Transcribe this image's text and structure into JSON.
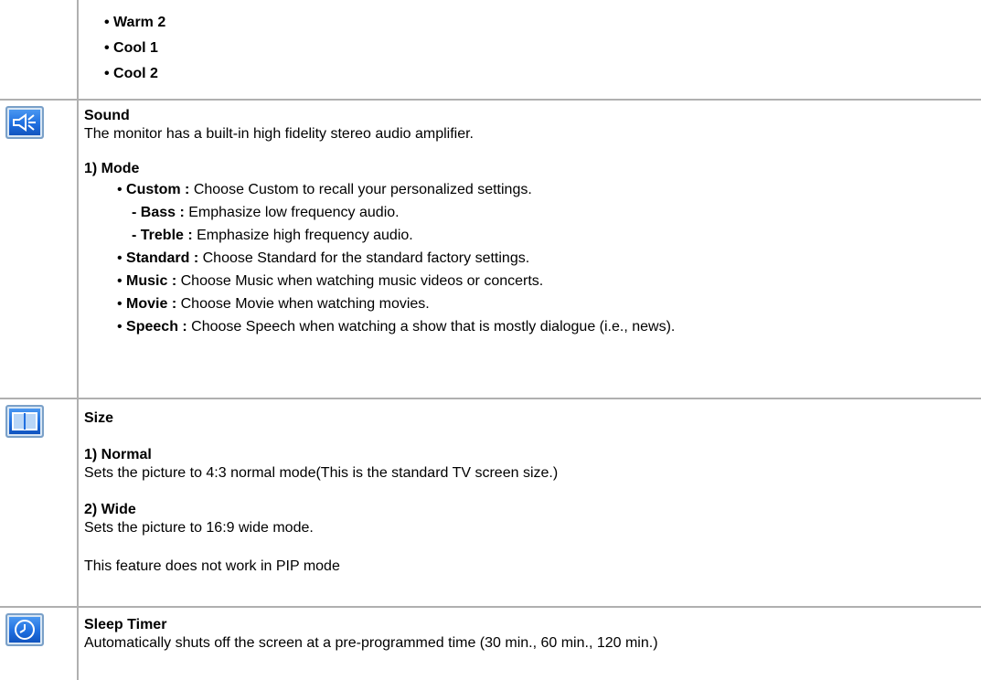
{
  "top": {
    "items": [
      "Warm 2",
      "Cool 1",
      "Cool 2"
    ]
  },
  "sound": {
    "icon": "speaker-icon",
    "title": "Sound",
    "description": "The monitor has a built-in high fidelity stereo audio amplifier.",
    "mode_heading": "1) Mode",
    "custom": {
      "label": "Custom :",
      "text": " Choose Custom to recall your personalized settings."
    },
    "bass": {
      "label": "- Bass :",
      "text": " Emphasize low frequency audio."
    },
    "treble": {
      "label": "- Treble :",
      "text": " Emphasize high frequency audio."
    },
    "standard": {
      "label": "Standard :",
      "text": " Choose Standard for the standard factory settings."
    },
    "music": {
      "label": "Music :",
      "text": " Choose Music when watching music videos or concerts."
    },
    "movie": {
      "label": "Movie :",
      "text": " Choose Movie when watching movies."
    },
    "speech": {
      "label": "Speech :",
      "text": " Choose Speech when watching a show that is mostly dialogue (i.e., news)."
    }
  },
  "size": {
    "icon": "screen-size-icon",
    "title": "Size",
    "normal_heading": "1) Normal",
    "normal_text": "Sets the picture to 4:3 normal mode(This is the standard TV screen size.)",
    "wide_heading": "2) Wide",
    "wide_text": "Sets the picture to 16:9 wide mode.",
    "note": "This feature does not work in PIP mode"
  },
  "sleep": {
    "icon": "clock-icon",
    "title": "Sleep Timer",
    "description": "Automatically shuts off the screen at a pre-programmed time (30 min., 60 min., 120 min.)"
  },
  "colors": {
    "border": "#b0b0b0",
    "icon_blue": "#1f6fe0"
  }
}
